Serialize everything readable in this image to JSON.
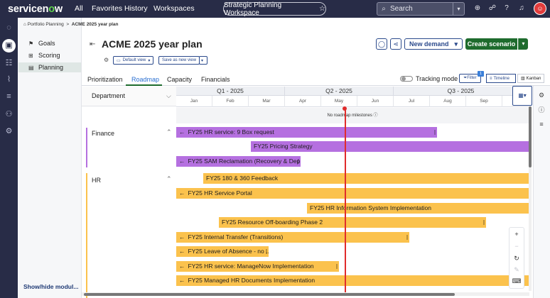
{
  "topbar": {
    "logo_text": "servicen",
    "logo_o": "o",
    "logo_text2": "w",
    "nav": [
      "All",
      "Favorites",
      "History",
      "Workspaces"
    ],
    "workspace": "Strategic Planning Workspace",
    "search_placeholder": "Search"
  },
  "breadcrumb": {
    "parent": "Portfolio Planning",
    "separator": ">",
    "current": "ACME 2025 year plan"
  },
  "sidenav": {
    "items": [
      {
        "label": "Goals",
        "icon": "flag-icon"
      },
      {
        "label": "Scoring",
        "icon": "scoring-icon"
      },
      {
        "label": "Planning",
        "icon": "planning-icon"
      }
    ],
    "show_hide": "Show/hide modul..."
  },
  "header": {
    "title": "ACME 2025 year plan",
    "new_demand": "New demand",
    "create_scenario": "Create scenario",
    "default_view": "Default view",
    "save_as_new_view": "Save as new view"
  },
  "tabs": [
    "Prioritization",
    "Roadmap",
    "Capacity",
    "Financials"
  ],
  "active_tab": "Roadmap",
  "controls": {
    "tracking_mode": "Tracking mode",
    "filter": "Filter",
    "filter_count": "1",
    "timeline": "Timeline",
    "kanban": "Kanban"
  },
  "department_header": "Department",
  "timeline": {
    "quarters": [
      "Q1 - 2025",
      "Q2 - 2025",
      "Q3 - 2025"
    ],
    "months": [
      "Jan",
      "Feb",
      "Mar",
      "Apr",
      "May",
      "Jun",
      "Jul",
      "Aug",
      "Sep"
    ],
    "milestones_text": "No roadmap milestones"
  },
  "groups": [
    {
      "name": "Finance",
      "color": "#b570e0",
      "items": [
        "FY25 HR service: 9 Box request",
        "FY25 Pricing Strategy",
        "FY25 SAM Reclamation (Recovery & Dep..."
      ]
    },
    {
      "name": "HR",
      "color": "#fbc24d",
      "items": [
        "FY25 180 & 360 Feedback",
        "FY25 HR Service Portal",
        "FY25 HR Information System Implementation",
        "FY25 Resource Off-boarding Phase 2",
        "FY25 Internal Transfer (Transitions)",
        "FY25 Leave of Absence - no ...",
        "FY25 HR service: ManageNow Implementation",
        "FY25 Managed HR Documents Implementation"
      ]
    }
  ],
  "zoom_controls": [
    "plus-icon",
    "minus-icon",
    "reset-icon",
    "pen-icon",
    "keyboard-icon"
  ]
}
